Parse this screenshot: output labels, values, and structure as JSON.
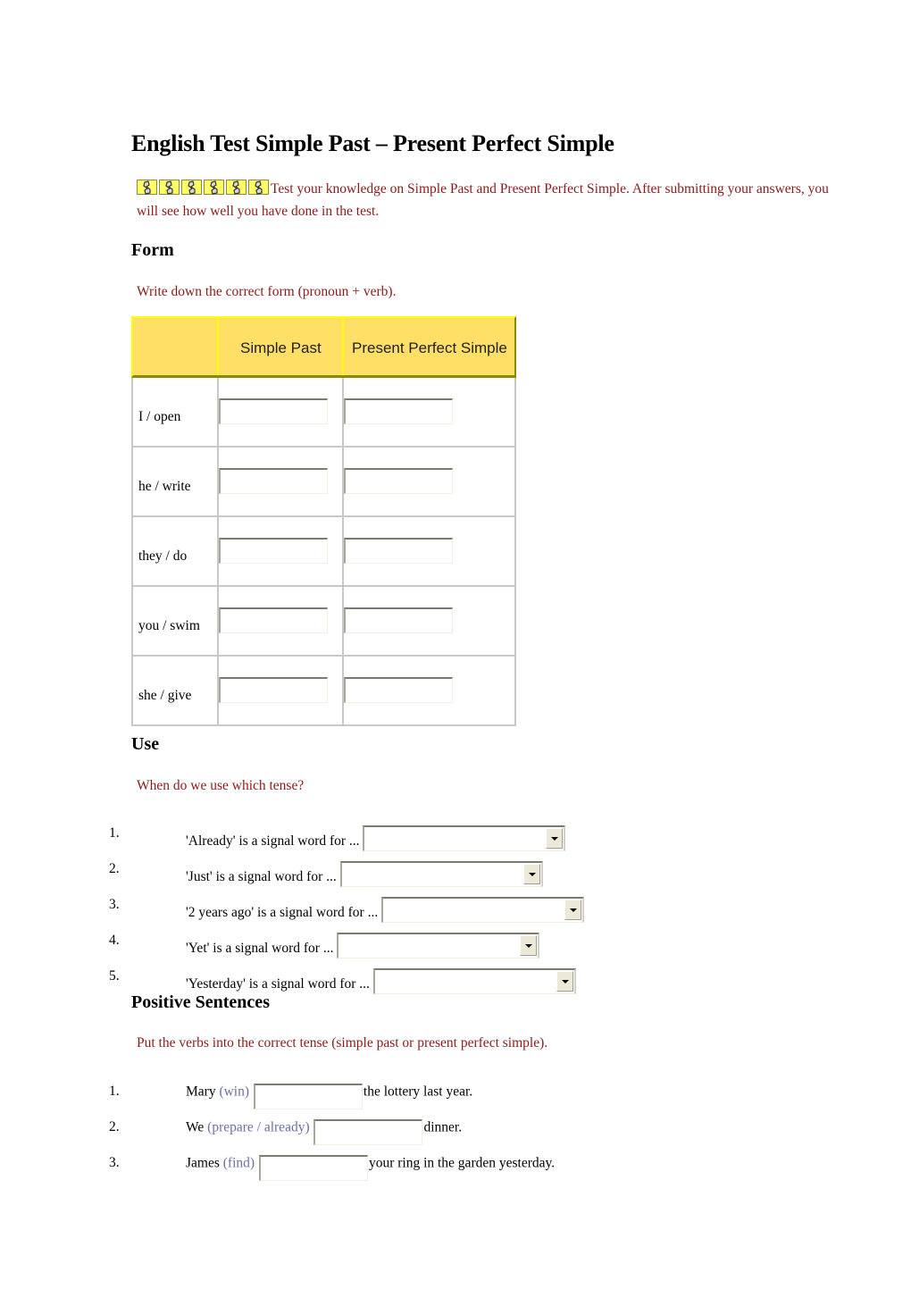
{
  "title": "English Test Simple Past – Present Perfect Simple",
  "rating": {
    "icon": "pill-rating-icon",
    "count": 6
  },
  "intro": "Test your knowledge on Simple Past and Present Perfect Simple. After submitting your answers, you will see how well you have done in the test.",
  "colors": {
    "instruction": "#8b1a1a",
    "header_bg": "#ffdf66",
    "hint": "#6b6fa3"
  },
  "form": {
    "heading": "Form",
    "instruction": "Write down the correct form (pronoun + verb).",
    "columns": [
      "",
      "Simple Past",
      "Present Perfect Simple"
    ],
    "rows": [
      {
        "label": "I / open",
        "simple_past": "",
        "present_perfect": ""
      },
      {
        "label": "he / write",
        "simple_past": "",
        "present_perfect": ""
      },
      {
        "label": "they / do",
        "simple_past": "",
        "present_perfect": ""
      },
      {
        "label": "you / swim",
        "simple_past": "",
        "present_perfect": ""
      },
      {
        "label": "she / give",
        "simple_past": "",
        "present_perfect": ""
      }
    ]
  },
  "use": {
    "heading": "Use",
    "instruction": "When do we use which tense?",
    "items": [
      {
        "num": "1.",
        "text": "'Already' is a signal word for ...",
        "selected": ""
      },
      {
        "num": "2.",
        "text": "'Just' is a signal word for ...",
        "selected": ""
      },
      {
        "num": "3.",
        "text": "'2 years ago' is a signal word for ...",
        "selected": ""
      },
      {
        "num": "4.",
        "text": "'Yet' is a signal word for ...",
        "selected": ""
      },
      {
        "num": "5.",
        "text": "'Yesterday' is a signal word for ...",
        "selected": ""
      }
    ]
  },
  "positive": {
    "heading": "Positive Sentences",
    "instruction": "Put the verbs into the correct tense (simple past or present perfect simple).",
    "items": [
      {
        "num": "1.",
        "before": "Mary",
        "hint": "(win)",
        "value": "",
        "after": "the lottery last year."
      },
      {
        "num": "2.",
        "before": "We",
        "hint": "(prepare / already)",
        "value": "",
        "after": "dinner."
      },
      {
        "num": "3.",
        "before": "James",
        "hint": "(find)",
        "value": "",
        "after": "your ring in the garden yesterday."
      }
    ]
  }
}
